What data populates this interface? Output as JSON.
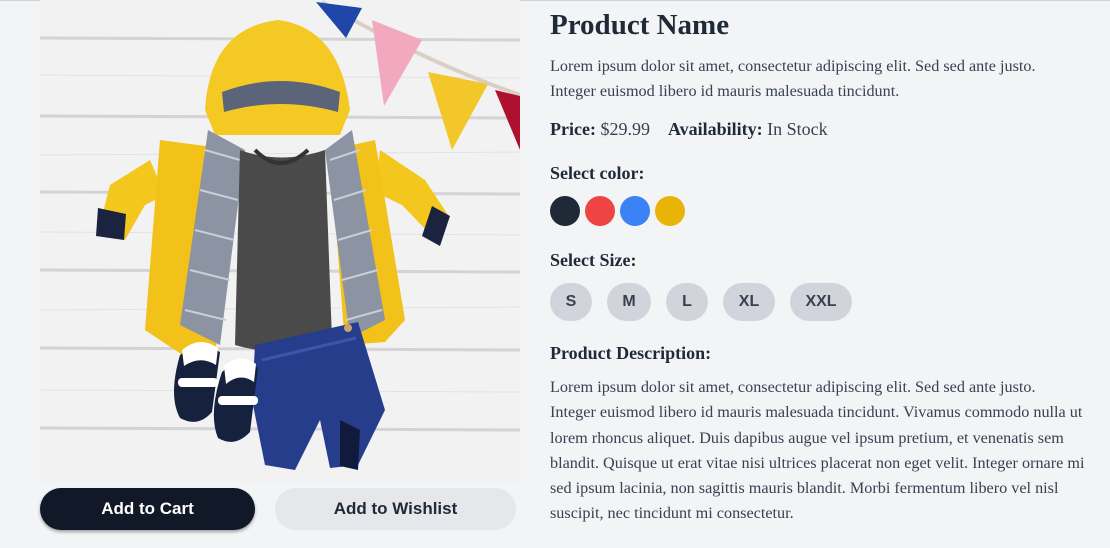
{
  "product": {
    "name": "Product Name",
    "intro": "Lorem ipsum dolor sit amet, consectetur adipiscing elit. Sed sed ante justo. Integer euismod libero id mauris malesuada tincidunt.",
    "price_label": "Price:",
    "price_value": "$29.99",
    "availability_label": "Availability:",
    "availability_value": "In Stock",
    "color_label": "Select color:",
    "colors": [
      "#1f2937",
      "#ef4444",
      "#3b82f6",
      "#eab308"
    ],
    "size_label": "Select Size:",
    "sizes": [
      "S",
      "M",
      "L",
      "XL",
      "XXL"
    ],
    "description_label": "Product Description:",
    "description": "Lorem ipsum dolor sit amet, consectetur adipiscing elit. Sed sed ante justo. Integer euismod libero id mauris malesuada tincidunt. Vivamus commodo nulla ut lorem rhoncus aliquet. Duis dapibus augue vel ipsum pretium, et venenatis sem blandit. Quisque ut erat vitae nisi ultrices placerat non eget velit. Integer ornare mi sed ipsum lacinia, non sagittis mauris blandit. Morbi fermentum libero vel nisl suscipit, nec tincidunt mi consectetur."
  },
  "actions": {
    "add_to_cart": "Add to Cart",
    "add_to_wishlist": "Add to Wishlist"
  },
  "image": {
    "subject": "yellow raincoat, grey t-shirt, denim shorts, sneakers and bunting on white planks"
  }
}
